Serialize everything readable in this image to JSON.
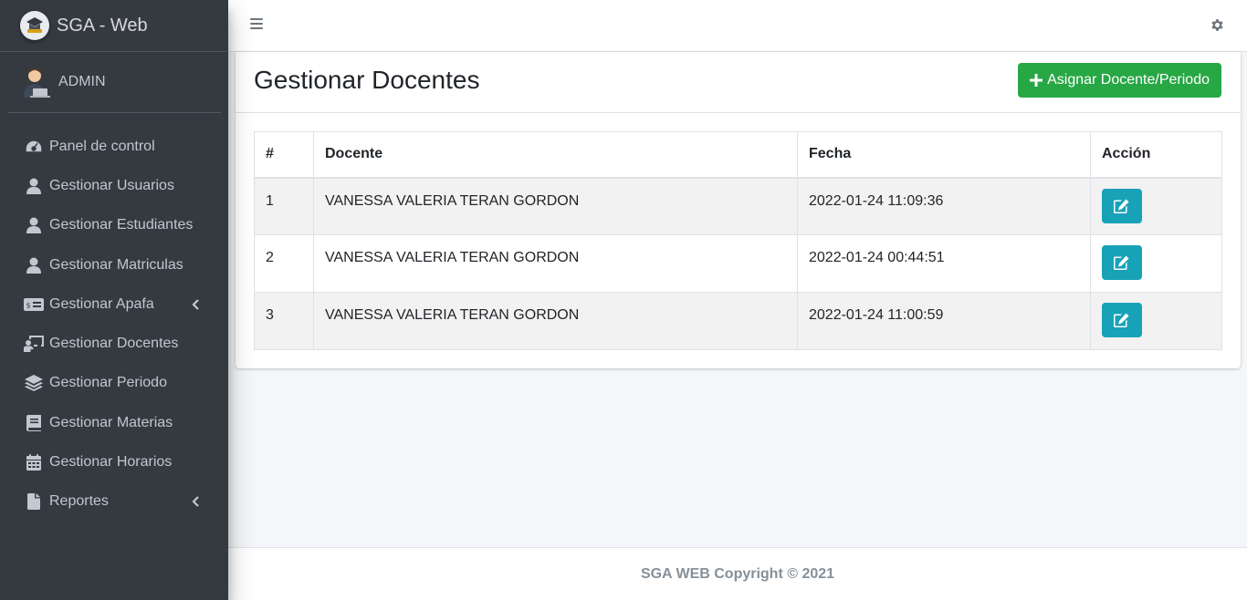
{
  "brand": {
    "title": "SGA - Web"
  },
  "user": {
    "name": "ADMIN"
  },
  "sidebar": {
    "items": [
      {
        "label": "Panel de control",
        "icon": "dashboard-icon"
      },
      {
        "label": "Gestionar Usuarios",
        "icon": "user-icon"
      },
      {
        "label": "Gestionar Estudiantes",
        "icon": "user-icon"
      },
      {
        "label": "Gestionar Matriculas",
        "icon": "user-icon"
      },
      {
        "label": "Gestionar Apafa",
        "icon": "money-bill-icon",
        "has_submenu": true
      },
      {
        "label": "Gestionar Docentes",
        "icon": "chalkboard-teacher-icon"
      },
      {
        "label": "Gestionar Periodo",
        "icon": "layers-icon"
      },
      {
        "label": "Gestionar Materias",
        "icon": "book-icon"
      },
      {
        "label": "Gestionar Horarios",
        "icon": "calendar-icon"
      },
      {
        "label": "Reportes",
        "icon": "file-icon",
        "has_submenu": true
      }
    ]
  },
  "page": {
    "title": "Gestionar Docentes",
    "assign_button_label": "Asignar Docente/Periodo"
  },
  "table": {
    "headers": [
      "#",
      "Docente",
      "Fecha",
      "Acción"
    ],
    "rows": [
      {
        "num": "1",
        "docente": "VANESSA VALERIA TERAN GORDON",
        "fecha": "2022-01-24 11:09:36"
      },
      {
        "num": "2",
        "docente": "VANESSA VALERIA TERAN GORDON",
        "fecha": "2022-01-24 00:44:51"
      },
      {
        "num": "3",
        "docente": "VANESSA VALERIA TERAN GORDON",
        "fecha": "2022-01-24 11:00:59"
      }
    ]
  },
  "footer": {
    "text": "SGA WEB Copyright © 2021"
  },
  "colors": {
    "sidebar_bg": "#343a40",
    "success": "#28a745",
    "info": "#17a2b8"
  }
}
